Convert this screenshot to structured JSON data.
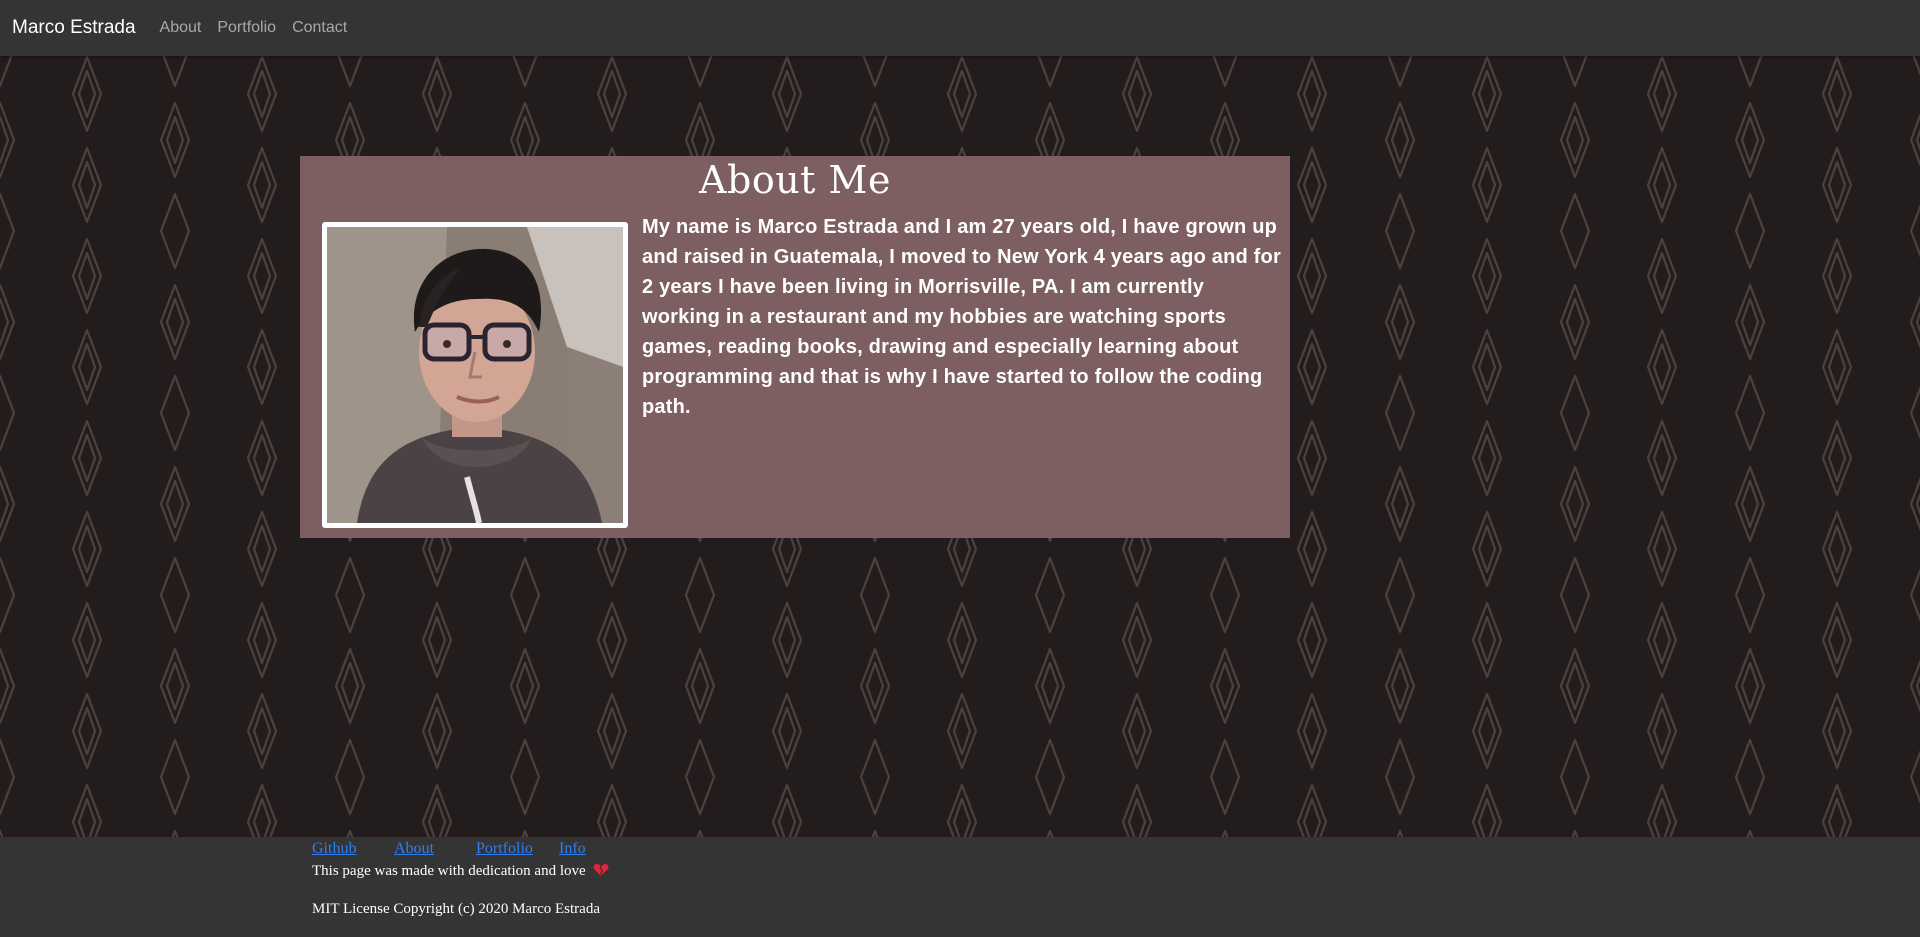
{
  "navbar": {
    "brand": "Marco Estrada",
    "links": [
      "About",
      "Portfolio",
      "Contact"
    ]
  },
  "about": {
    "title": "About Me",
    "photo_icon": "profile-photo",
    "text": "My name is Marco Estrada and I am 27 years old, I have grown up and raised in Guatemala, I moved to New York 4 years ago and for 2 years I have been living in Morrisville, PA. I am currently working in a restaurant and my hobbies are watching sports games, reading books, drawing and especially learning about programming and that is why I have started to follow the coding path."
  },
  "footer": {
    "links": [
      "Github",
      "About",
      "Portfolio",
      "Info"
    ],
    "tagline": "This page was made with dedication and love",
    "tagline_icon": "broken-heart-icon",
    "license": "MIT License Copyright (c) 2020 Marco Estrada"
  },
  "colors": {
    "background": "#231c1d",
    "pattern": "#4e3f40",
    "card": "#7d5f61",
    "navbar": "#343434",
    "link": "#2f7ff0"
  }
}
